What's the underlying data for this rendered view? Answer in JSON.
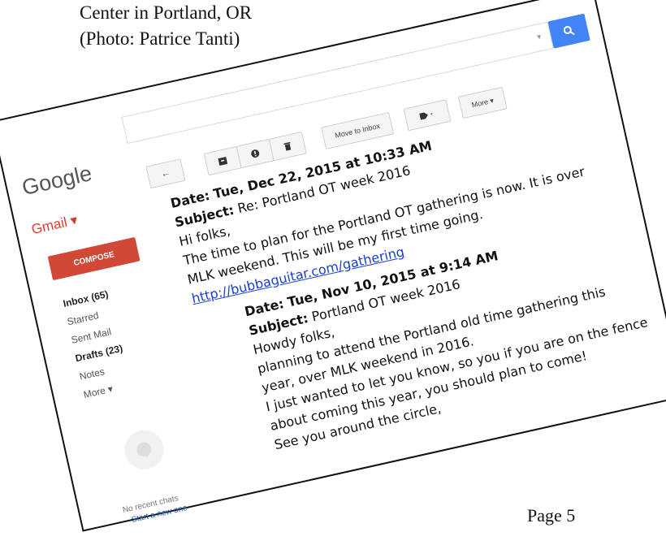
{
  "caption": {
    "line1": "Center in Portland, OR",
    "line2": "(Photo: Patrice Tanti)"
  },
  "page_number": "Page 5",
  "gmail": {
    "logo": "Google",
    "app_label": "Gmail ▾",
    "compose_label": "COMPOSE",
    "nav": {
      "inbox": "Inbox (65)",
      "starred": "Starred",
      "sent": "Sent Mail",
      "drafts": "Drafts (23)",
      "notes": "Notes",
      "more": "More ▾"
    },
    "toolbar": {
      "move_to_inbox": "Move to Inbox",
      "more": "More ▾"
    },
    "chat": {
      "no_recent": "No recent chats",
      "start_new": "Start a new one"
    }
  },
  "email1": {
    "date_label": "Date:",
    "date_value": "Tue, Dec 22, 2015 at 10:33 AM",
    "subject_label": "Subject:",
    "subject_value": "Re: Portland OT week 2016",
    "lines": [
      "Hi folks,",
      "The time to plan for the Portland OT gathering is now. It is over",
      "MLK weekend. This will be my first time going."
    ],
    "link": "http://bubbaguitar.com/gathering"
  },
  "email2": {
    "date_label": "Date:",
    "date_value": "Tue, Nov 10, 2015 at 9:14 AM",
    "subject_label": "Subject:",
    "subject_value": "Portland OT week 2016",
    "lines": [
      "Howdy folks,",
      "planning to attend the Portland old time gathering this",
      "year, over MLK weekend in 2016.",
      "I just wanted to let you know, so you if you are on the fence",
      "about coming this year, you should plan to come!",
      "See you around the circle,"
    ]
  },
  "colors": {
    "search_blue": "#4285f4",
    "compose_red": "#d14836",
    "gmail_red": "#d23f31",
    "link_blue": "#1a3fd1"
  }
}
